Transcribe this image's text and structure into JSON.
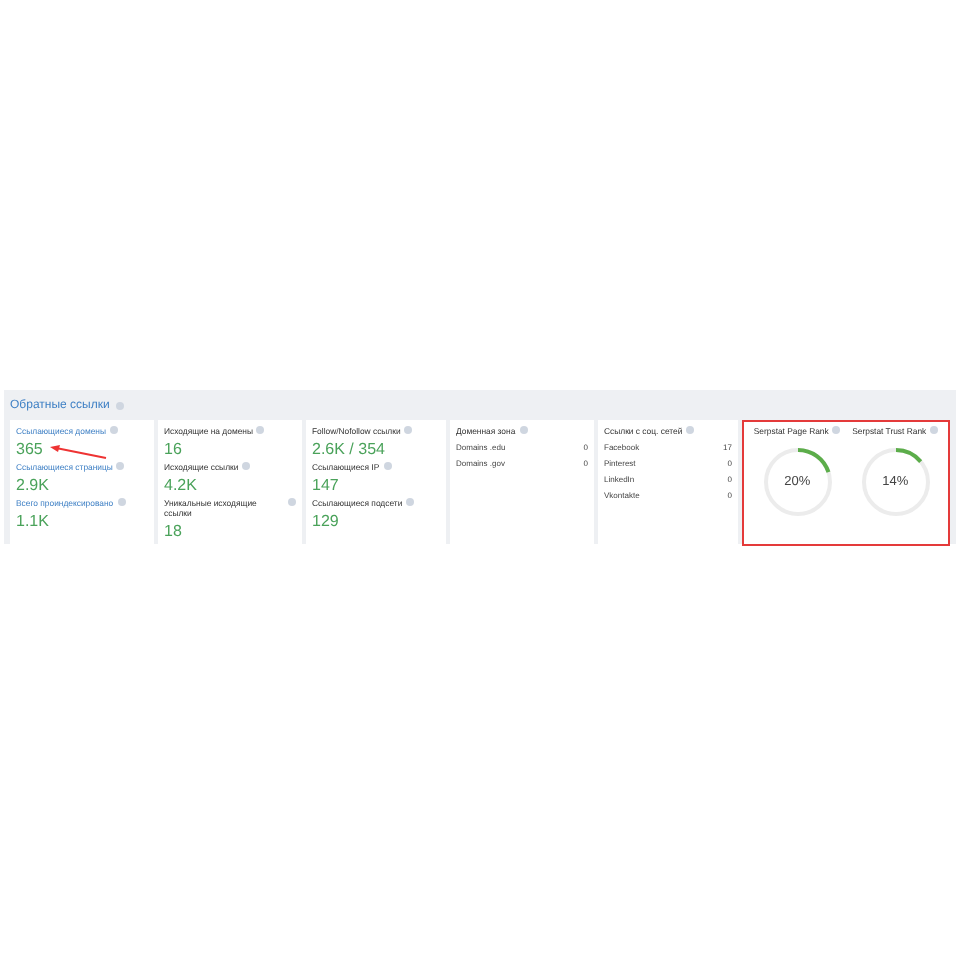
{
  "section": {
    "title": "Обратные ссылки"
  },
  "metric_columns": [
    {
      "metrics": [
        {
          "label": "Ссылающиеся домены",
          "value": "365",
          "link": true
        },
        {
          "label": "Ссылающиеся страницы",
          "value": "2.9K",
          "link": true
        },
        {
          "label": "Всего проиндексировано",
          "value": "1.1K",
          "link": true
        }
      ]
    },
    {
      "metrics": [
        {
          "label": "Исходящие на домены",
          "value": "16",
          "link": false
        },
        {
          "label": "Исходящие ссылки",
          "value": "4.2K",
          "link": false
        },
        {
          "label": "Уникальные исходящие ссылки",
          "value": "18",
          "link": false
        }
      ]
    },
    {
      "metrics": [
        {
          "label": "Follow/Nofollow ссылки",
          "value": "2.6K / 354",
          "link": false
        },
        {
          "label": "Ссылающиеся IP",
          "value": "147",
          "link": false
        },
        {
          "label": "Ссылающиеся подсети",
          "value": "129",
          "link": false
        }
      ]
    }
  ],
  "list_columns": [
    {
      "title": "Доменная зона",
      "rows": [
        {
          "name": "Domains .edu",
          "count": "0"
        },
        {
          "name": "Domains .gov",
          "count": "0"
        }
      ]
    },
    {
      "title": "Ссылки с соц. сетей",
      "rows": [
        {
          "name": "Facebook",
          "count": "17"
        },
        {
          "name": "Pinterest",
          "count": "0"
        },
        {
          "name": "LinkedIn",
          "count": "0"
        },
        {
          "name": "Vkontakte",
          "count": "0"
        }
      ]
    }
  ],
  "ranks": [
    {
      "label": "Serpstat Page Rank",
      "reading": "20%",
      "level": 0.2
    },
    {
      "label": "Serpstat Trust Rank",
      "reading": "14%",
      "level": 0.14
    }
  ]
}
